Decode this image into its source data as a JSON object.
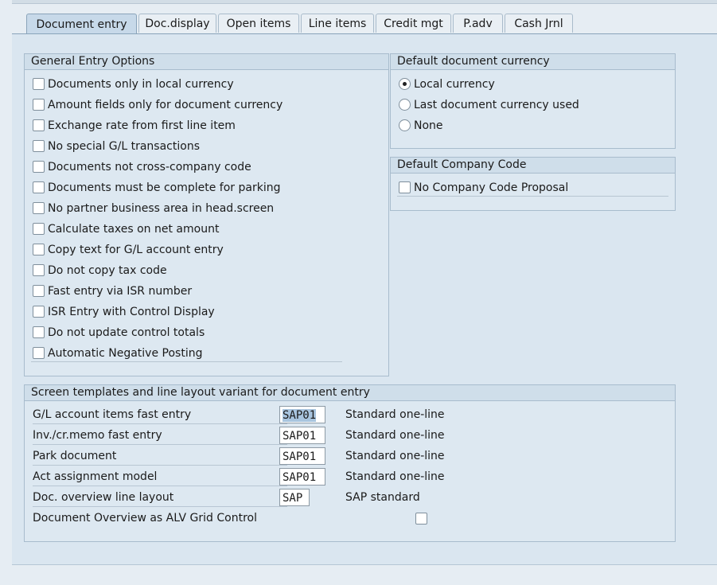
{
  "tabs": [
    {
      "label": "Document entry",
      "active": true
    },
    {
      "label": "Doc.display",
      "active": false
    },
    {
      "label": "Open items",
      "active": false
    },
    {
      "label": "Line items",
      "active": false
    },
    {
      "label": "Credit mgt",
      "active": false
    },
    {
      "label": "P.adv",
      "active": false
    },
    {
      "label": "Cash Jrnl",
      "active": false
    }
  ],
  "general_entry": {
    "title": "General Entry Options",
    "options": [
      {
        "label": "Documents only in local currency",
        "checked": false
      },
      {
        "label": "Amount fields only for document currency",
        "checked": false
      },
      {
        "label": "Exchange rate from first line item",
        "checked": false
      },
      {
        "label": "No special G/L transactions",
        "checked": false
      },
      {
        "label": "Documents not cross-company code",
        "checked": false
      },
      {
        "label": "Documents must be complete for parking",
        "checked": false
      },
      {
        "label": "No partner business area in head.screen",
        "checked": false
      },
      {
        "label": "Calculate taxes on net amount",
        "checked": false
      },
      {
        "label": "Copy text for G/L account entry",
        "checked": false
      },
      {
        "label": "Do not copy tax code",
        "checked": false
      },
      {
        "label": "Fast entry via ISR number",
        "checked": false
      },
      {
        "label": "ISR Entry with Control Display",
        "checked": false
      },
      {
        "label": "Do not update control totals",
        "checked": false
      },
      {
        "label": "Automatic Negative Posting",
        "checked": false
      }
    ]
  },
  "default_currency": {
    "title": "Default document currency",
    "options": [
      {
        "label": "Local currency",
        "selected": true
      },
      {
        "label": "Last document currency used",
        "selected": false
      },
      {
        "label": "None",
        "selected": false
      }
    ]
  },
  "default_company": {
    "title": "Default Company Code",
    "options": [
      {
        "label": "No Company Code Proposal",
        "checked": false
      }
    ]
  },
  "screen_templates": {
    "title": "Screen templates and line layout variant for document entry",
    "rows": [
      {
        "label": "G/L account items fast entry",
        "value": "SAP01",
        "desc": "Standard one-line"
      },
      {
        "label": "Inv./cr.memo fast entry",
        "value": "SAP01",
        "desc": "Standard one-line"
      },
      {
        "label": "Park document",
        "value": "SAP01",
        "desc": "Standard one-line"
      },
      {
        "label": "Act assignment model",
        "value": "SAP01",
        "desc": "Standard one-line"
      },
      {
        "label": "Doc. overview line layout",
        "value": "SAP",
        "desc": "SAP standard"
      }
    ],
    "alv_label": "Document Overview as ALV Grid Control",
    "alv_checked": false
  }
}
